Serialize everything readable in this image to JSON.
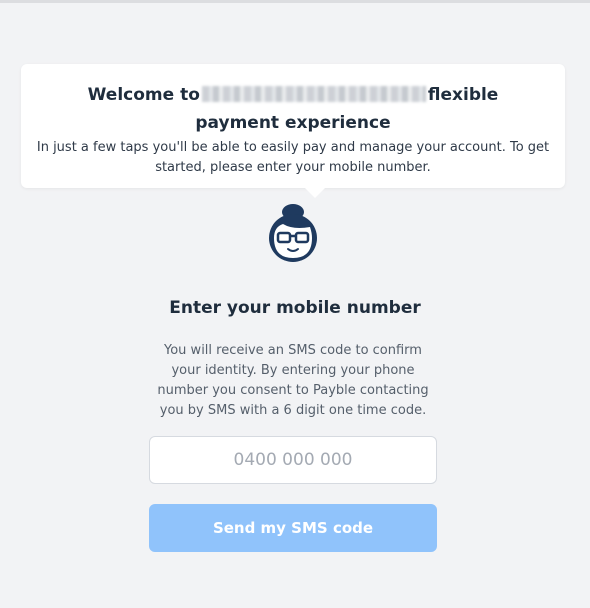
{
  "welcome": {
    "title_prefix": "Welcome to",
    "title_suffix": "flexible payment experience",
    "description": "In just a few taps you'll be able to easily pay and manage your account. To get started, please enter your mobile number."
  },
  "form": {
    "heading": "Enter your mobile number",
    "info": "You will receive an SMS code to confirm your identity. By entering your phone number you consent to Payble contacting you by SMS with a 6 digit one time code.",
    "phone_placeholder": "0400 000 000",
    "phone_value": "",
    "submit_label": "Send my SMS code"
  },
  "icons": {
    "avatar": "woman-with-glasses-avatar-icon"
  },
  "colors": {
    "primary_text": "#1f2d3d",
    "button_disabled": "#90c3fb",
    "page_background": "#f2f3f5"
  }
}
